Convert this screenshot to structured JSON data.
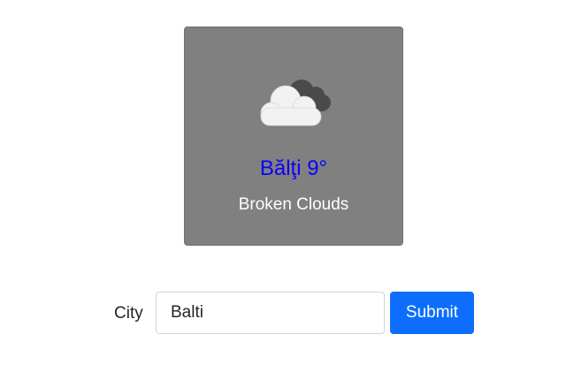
{
  "weather": {
    "city": "Bălţi",
    "temperature": "9°",
    "title": "Bălţi 9°",
    "description": "Broken Clouds",
    "icon": "broken-clouds-icon",
    "colors": {
      "card_background": "#808080",
      "title": "#0b00ff",
      "description": "#ffffff"
    }
  },
  "form": {
    "city_label": "City",
    "city_value": "Balti",
    "submit_label": "Submit",
    "colors": {
      "submit_background": "#0d6efd"
    }
  }
}
